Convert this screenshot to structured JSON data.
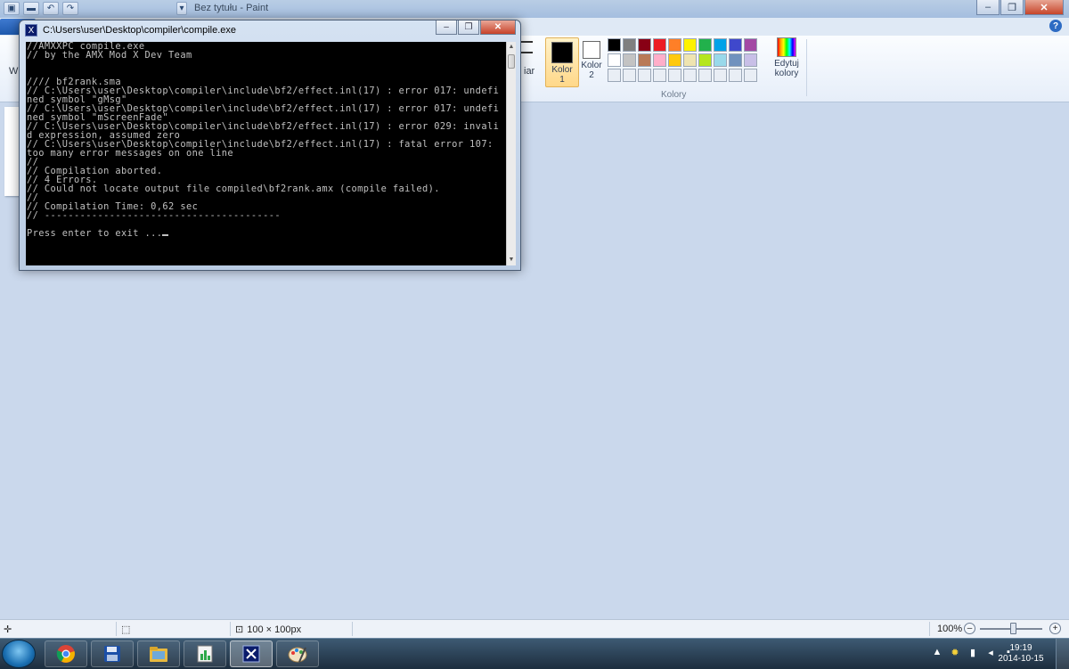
{
  "paint": {
    "title": "Bez tytułu - Paint",
    "ribbon_fragments": {
      "left_cut": "W",
      "size_fragment": "iar"
    },
    "colors_group": {
      "label": "Kolory",
      "color1": {
        "label": "Kolor",
        "number": "1",
        "value": "#000000"
      },
      "color2": {
        "label": "Kolor",
        "number": "2",
        "value": "#ffffff"
      },
      "edit_colors_line1": "Edytuj",
      "edit_colors_line2": "kolory",
      "palette_row1": [
        "#000000",
        "#7f7f7f",
        "#880015",
        "#ed1c24",
        "#ff7f27",
        "#fff200",
        "#22b14c",
        "#00a2e8",
        "#3f48cc",
        "#a349a4"
      ],
      "palette_row2": [
        "#ffffff",
        "#c3c3c3",
        "#b97a57",
        "#ffaec9",
        "#ffc90e",
        "#efe4b0",
        "#b5e61d",
        "#99d9ea",
        "#7092be",
        "#c8bfe7"
      ],
      "palette_row3": [
        "",
        "",
        "",
        "",
        "",
        "",
        "",
        "",
        "",
        ""
      ]
    },
    "status": {
      "canvas_size": "100 × 100px",
      "zoom": "100%"
    },
    "help_icon": "?"
  },
  "console": {
    "title": "C:\\Users\\user\\Desktop\\compiler\\compile.exe",
    "text": "//AMXXPC compile.exe\n// by the AMX Mod X Dev Team\n\n\n//// bf2rank.sma\n// C:\\Users\\user\\Desktop\\compiler\\include\\bf2/effect.inl(17) : error 017: undefi\nned symbol \"gMsg\"\n// C:\\Users\\user\\Desktop\\compiler\\include\\bf2/effect.inl(17) : error 017: undefi\nned symbol \"mScreenFade\"\n// C:\\Users\\user\\Desktop\\compiler\\include\\bf2/effect.inl(17) : error 029: invali\nd expression, assumed zero\n// C:\\Users\\user\\Desktop\\compiler\\include\\bf2/effect.inl(17) : fatal error 107:\ntoo many error messages on one line\n//\n// Compilation aborted.\n// 4 Errors.\n// Could not locate output file compiled\\bf2rank.amx (compile failed).\n//\n// Compilation Time: 0,62 sec\n// ----------------------------------------\n\nPress enter to exit ..."
  },
  "taskbar": {
    "apps": [
      "chrome-icon",
      "save-disk-icon",
      "explorer-folder-icon",
      "task-manager-icon",
      "console-icon",
      "paint-icon"
    ],
    "clock_time": "19:19",
    "clock_date": "2014-10-15"
  }
}
